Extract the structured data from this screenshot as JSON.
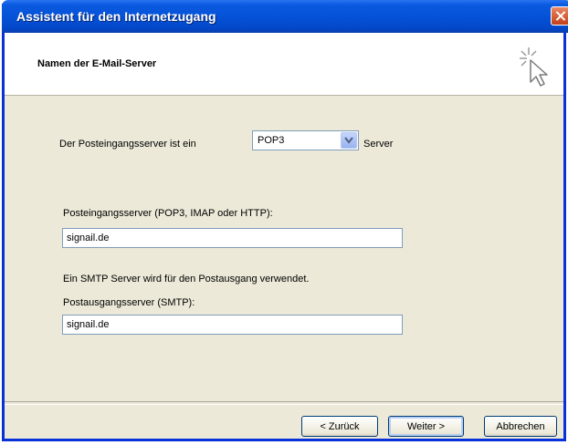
{
  "window": {
    "title": "Assistent für den Internetzugang"
  },
  "header": {
    "title": "Namen der E-Mail-Server"
  },
  "incoming": {
    "prefix_label": "Der Posteingangsserver ist ein",
    "server_type": "POP3",
    "suffix_label": "Server",
    "server_label": "Posteingangsserver (POP3, IMAP oder HTTP):",
    "server_value": "signail.de"
  },
  "outgoing": {
    "info_text": "Ein SMTP Server wird für den Postausgang verwendet.",
    "server_label": "Postausgangsserver (SMTP):",
    "server_value": "signail.de"
  },
  "buttons": {
    "back": "< Zurück",
    "next": "Weiter >",
    "cancel": "Abbrechen"
  },
  "icons": {
    "wizard": "wizard-cursor-icon",
    "close": "close-icon",
    "dropdown": "chevron-down-icon"
  },
  "colors": {
    "titlebar": "#0452d8",
    "dialog_bg": "#ece9d8",
    "field_border": "#7f9db9"
  }
}
